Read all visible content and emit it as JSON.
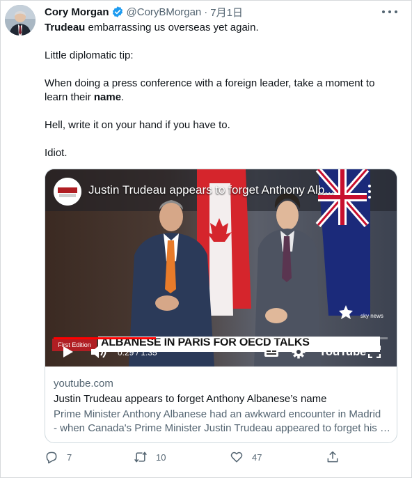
{
  "tweet": {
    "author_name": "Cory Morgan",
    "handle": "@CoryBMorgan",
    "date": "7月1日",
    "separator": "·",
    "line1_bold": "Trudeau",
    "line1_rest": " embarrassing us overseas yet again.",
    "para2": "Little diplomatic tip:",
    "para3_start": "When doing a press conference with a foreign leader, take a moment to learn their ",
    "para3_bold": "name",
    "para3_end": ".",
    "para4": "Hell, write it on your hand if you have to.",
    "para5": "Idiot."
  },
  "video": {
    "title": "Justin Trudeau appears to forget Anthony Alb...",
    "logo_text": "sky news",
    "chyron": "ALBANESE IN PARIS FOR OECD TALKS",
    "edition_label": "First Edition",
    "time": "0:29 / 1:35",
    "progress_fraction": 0.307,
    "platform_label": "YouTube",
    "corner_logo": "sky news"
  },
  "card": {
    "domain": "youtube.com",
    "title": "Justin Trudeau appears to forget Anthony Albanese’s name",
    "description_line1": "Prime Minister Anthony Albanese had an awkward encounter in Madrid",
    "description_line2": "- when Canada's Prime Minister Justin Trudeau appeared to forget his …"
  },
  "actions": {
    "replies": "7",
    "retweets": "10",
    "likes": "47"
  },
  "colors": {
    "text": "#0f1419",
    "secondary": "#536471",
    "verified": "#1d9bf0",
    "progress": "#ff0000"
  }
}
